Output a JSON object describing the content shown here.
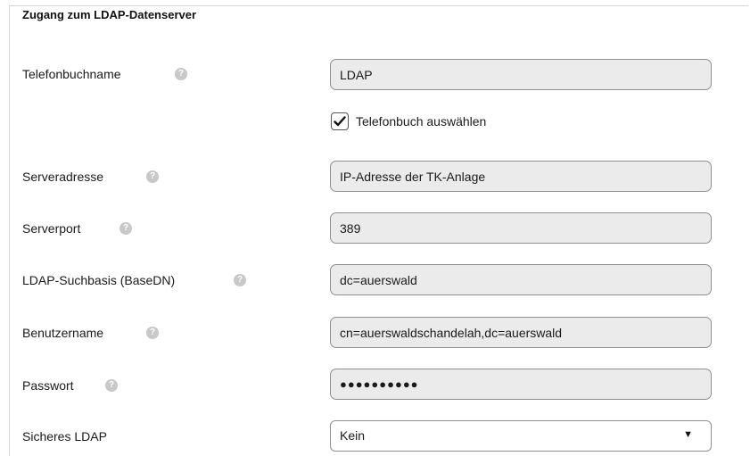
{
  "section": {
    "title": "Zugang zum LDAP-Datenserver"
  },
  "fields": {
    "phonebook_name": {
      "label": "Telefonbuchname",
      "value": "LDAP"
    },
    "select_phonebook": {
      "label": "Telefonbuch auswählen",
      "checked": true
    },
    "server_address": {
      "label": "Serveradresse",
      "value": "IP-Adresse der TK-Anlage"
    },
    "server_port": {
      "label": "Serverport",
      "value": "389"
    },
    "search_base": {
      "label": "LDAP-Suchbasis (BaseDN)",
      "value": "dc=auerswald"
    },
    "username": {
      "label": "Benutzername",
      "value": "cn=auerswaldschandelah,dc=auerswald"
    },
    "password": {
      "label": "Passwort",
      "value": "●●●●●●●●●●"
    },
    "secure_ldap": {
      "label": "Sicheres LDAP",
      "value": "Kein"
    }
  },
  "icons": {
    "help": "help-icon",
    "checkmark": "checkmark-icon",
    "dropdown": "dropdown-arrow-icon"
  },
  "glyphs": {
    "help": "?",
    "arrow": "▼"
  },
  "colors": {
    "field_bg": "#ebebeb",
    "field_border": "#8f8f8f",
    "help_icon": "#c8c8c8"
  }
}
